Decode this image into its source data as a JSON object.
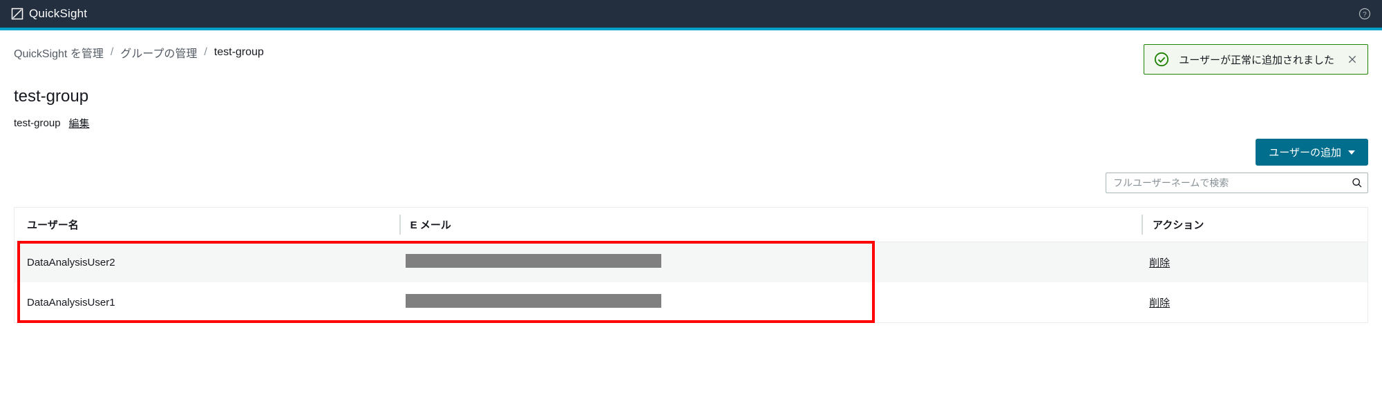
{
  "brand": "QuickSight",
  "breadcrumb": {
    "items": [
      "QuickSight を管理",
      "グループの管理",
      "test-group"
    ]
  },
  "toast": {
    "message": "ユーザーが正常に追加されました"
  },
  "page": {
    "title": "test-group",
    "subtitle": "test-group",
    "edit_label": "編集"
  },
  "actions": {
    "add_user_label": "ユーザーの追加"
  },
  "search": {
    "placeholder": "フルユーザーネームで検索"
  },
  "table": {
    "headers": {
      "user": "ユーザー名",
      "email": "E メール",
      "action": "アクション"
    },
    "rows": [
      {
        "user": "DataAnalysisUser2",
        "email_redacted": true,
        "action": "削除"
      },
      {
        "user": "DataAnalysisUser1",
        "email_redacted": true,
        "action": "削除"
      }
    ]
  }
}
